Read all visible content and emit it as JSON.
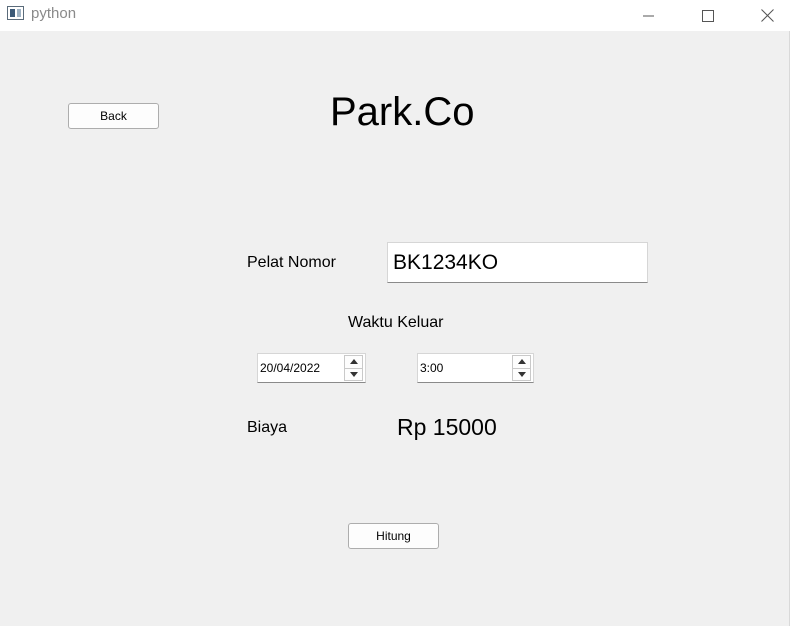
{
  "window": {
    "title": "python",
    "icon": "python-window-icon",
    "controls": [
      "minimize-icon",
      "maximize-icon",
      "close-icon"
    ]
  },
  "app": {
    "title": "Park.Co",
    "back_label": "Back"
  },
  "form": {
    "plate_label": "Pelat Nomor",
    "plate_value": "BK1234KO",
    "exit_time_label": "Waktu Keluar",
    "exit_date": "20/04/2022",
    "exit_time": "3:00",
    "cost_label": "Biaya",
    "cost_value": "Rp 15000",
    "calculate_label": "Hitung"
  }
}
